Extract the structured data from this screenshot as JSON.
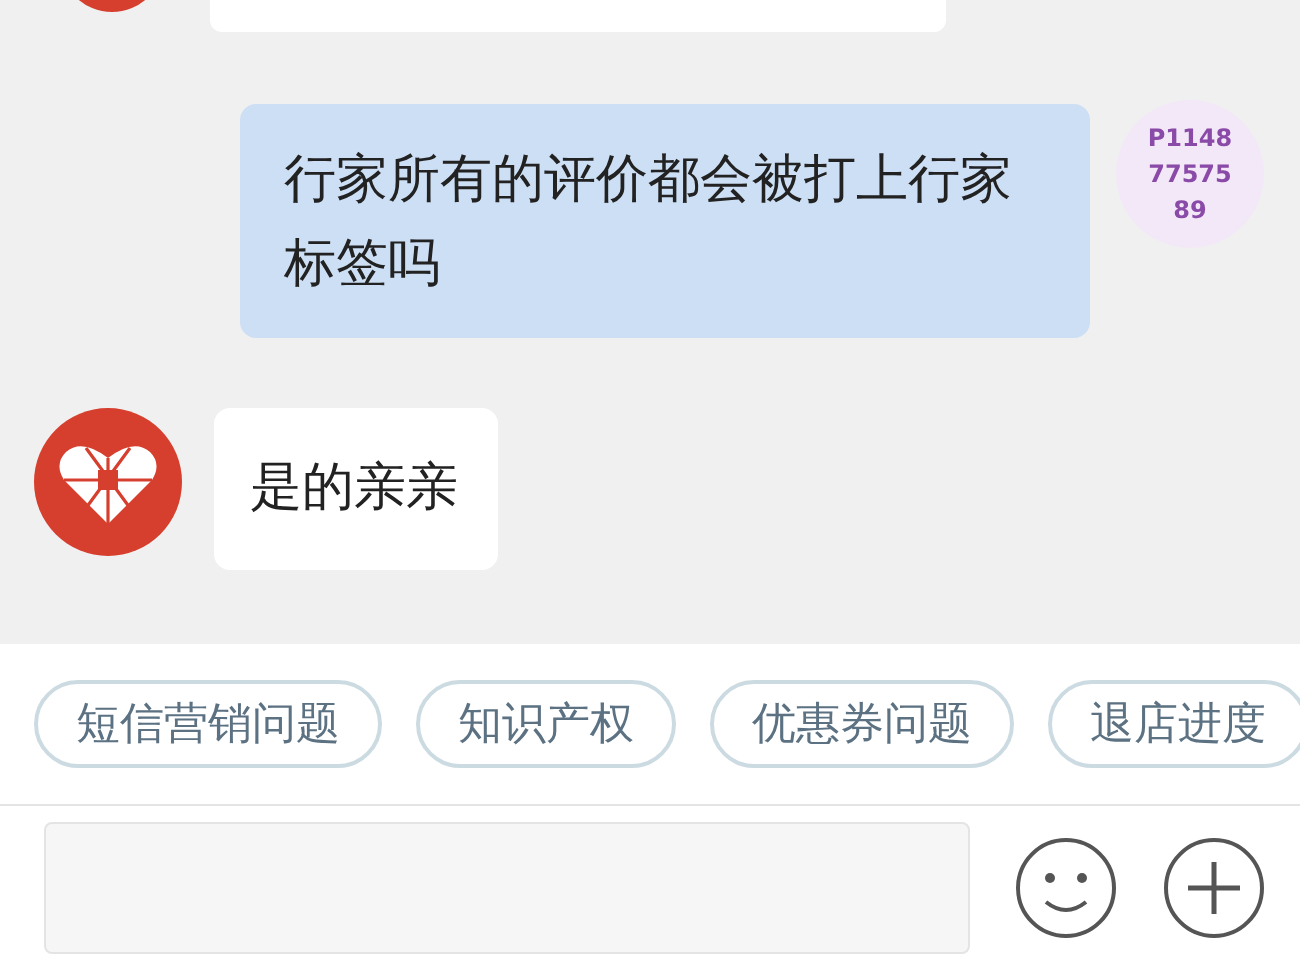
{
  "messages": [
    {
      "kind": "agent"
    },
    {
      "kind": "user",
      "avatar_text": "P11487757589",
      "text": "行家所有的评价都会被打上行家标签吗"
    },
    {
      "kind": "agent",
      "text": "是的亲亲"
    }
  ],
  "quick_replies": [
    "短信营销问题",
    "知识产权",
    "优惠券问题",
    "退店进度"
  ]
}
